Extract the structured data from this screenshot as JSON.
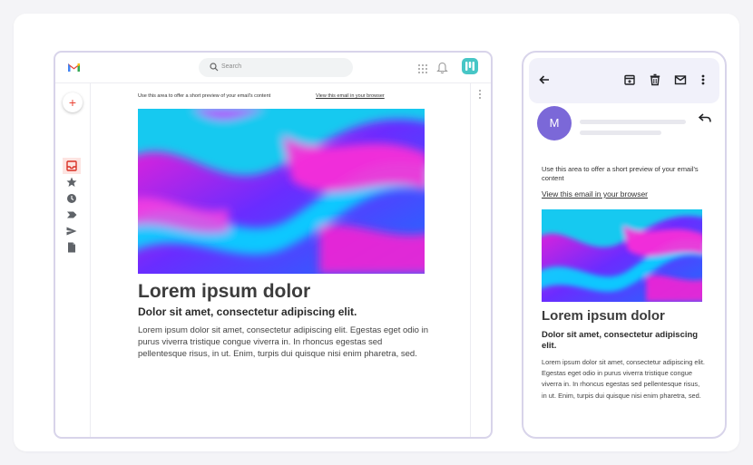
{
  "desktop": {
    "search": {
      "placeholder": "Search",
      "icon": "search-icon"
    },
    "header_icons": [
      "gmail-logo",
      "apps-grid-icon",
      "bell-icon",
      "brand-logo"
    ],
    "sidebar": {
      "compose_label": "+",
      "items": [
        "inbox-icon",
        "star-icon",
        "clock-icon",
        "label-icon",
        "send-icon",
        "document-icon"
      ]
    },
    "email": {
      "preview_text": "Use this area to offer a short preview of your email's content",
      "view_link": "View this email in your browser",
      "heading": "Lorem ipsum dolor",
      "subheading": "Dolor sit amet, consectetur adipiscing elit.",
      "body": "Lorem ipsum dolor sit amet, consectetur adipiscing elit. Egestas eget odio in purus viverra tristique congue viverra in. In rhoncus egestas sed pellentesque risus, in ut. Enim, turpis dui quisque nisi enim pharetra, sed."
    }
  },
  "mobile": {
    "toolbar_icons": [
      "back-arrow-icon",
      "archive-icon",
      "trash-icon",
      "mail-icon",
      "more-vert-icon"
    ],
    "avatar_letter": "M",
    "email": {
      "preview_text": "Use this area to offer a short preview of your email's content",
      "view_link": "View this email in your browser",
      "heading": "Lorem ipsum dolor",
      "subheading": "Dolor sit amet, consectetur adipiscing elit.",
      "body": "Lorem ipsum dolor sit amet, consectetur adipiscing elit. Egestas eget odio in purus viverra tristique congue viverra in. In rhoncus egestas sed pellentesque risus, in ut. Enim, turpis dui quisque nisi enim pharetra, sed."
    }
  },
  "colors": {
    "frame_border": "#d8d4ea",
    "avatar": "#7b68d8",
    "brand": "#47c6c6",
    "toolbar_bg": "#f1f1fa"
  }
}
